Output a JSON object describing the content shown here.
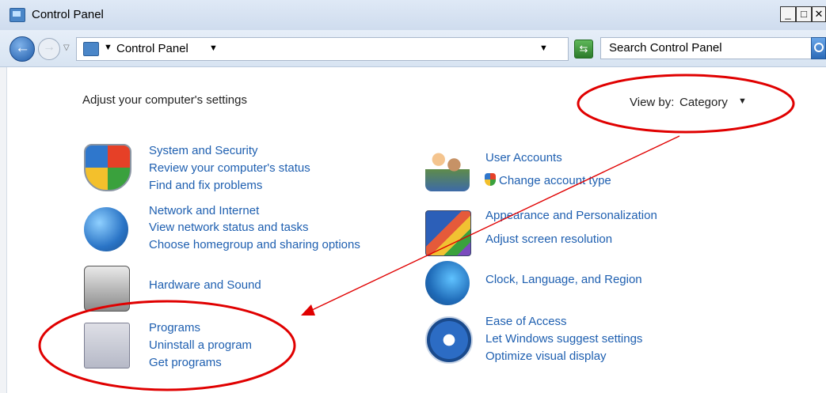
{
  "window": {
    "title": "Control Panel",
    "minimize": "_",
    "maximize": "□",
    "close": "✕"
  },
  "address": {
    "crumb": "Control Panel",
    "search_placeholder": "Search Control Panel"
  },
  "main": {
    "heading": "Adjust your computer's settings",
    "view_by_label": "View by:",
    "view_by_value": "Category",
    "categories": [
      {
        "title": "System and Security",
        "links": [
          "Review your computer's status",
          "Find and fix problems"
        ],
        "icon": "shield-icon"
      },
      {
        "title": "Network and Internet",
        "links": [
          "View network status and tasks",
          "Choose homegroup and sharing options"
        ],
        "icon": "network-globe-icon"
      },
      {
        "title": "Hardware and Sound",
        "links": [],
        "icon": "printer-icon"
      },
      {
        "title": "Programs",
        "links": [
          "Uninstall a program",
          "Get programs"
        ],
        "icon": "programs-box-icon"
      },
      {
        "title": "User Accounts",
        "links": [
          "Change account type"
        ],
        "icon": "users-icon"
      },
      {
        "title": "Appearance and Personalization",
        "links": [
          "Adjust screen resolution"
        ],
        "icon": "appearance-icon"
      },
      {
        "title": "Clock, Language, and Region",
        "links": [],
        "icon": "clock-globe-icon"
      },
      {
        "title": "Ease of Access",
        "links": [
          "Let Windows suggest settings",
          "Optimize visual display"
        ],
        "icon": "ease-of-access-icon"
      }
    ]
  },
  "annotation": {
    "stroke_color": "#e00000"
  }
}
